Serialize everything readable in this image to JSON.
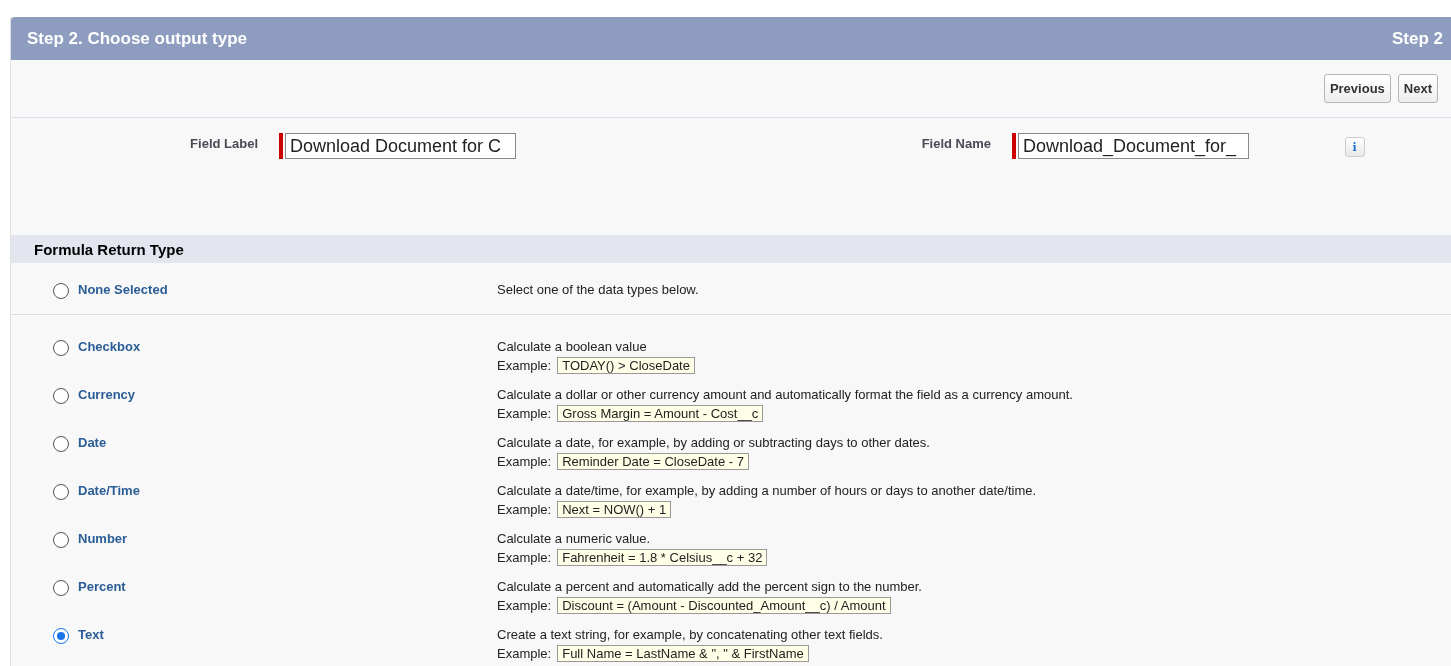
{
  "header": {
    "title": "Step 2. Choose output type",
    "step": "Step 2"
  },
  "buttons": [
    "Previous",
    "Next"
  ],
  "fields": [
    {
      "label": "Field Label",
      "value": "Download Document for C",
      "required": true
    },
    {
      "label": "Field Name",
      "value": "Download_Document_for_",
      "required": true,
      "info": "i"
    }
  ],
  "section": {
    "title": "Formula Return Type"
  },
  "types": [
    {
      "label": "None Selected",
      "selected": false,
      "description": "Select one of the data types below."
    },
    {
      "label": "Checkbox",
      "selected": false,
      "description": "Calculate a boolean value",
      "example_label": "Example:",
      "example": "TODAY() > CloseDate"
    },
    {
      "label": "Currency",
      "selected": false,
      "description": "Calculate a dollar or other currency amount and automatically format the field as a currency amount.",
      "example_label": "Example:",
      "example": "Gross Margin = Amount - Cost__c"
    },
    {
      "label": "Date",
      "selected": false,
      "description": "Calculate a date, for example, by adding or subtracting days to other dates.",
      "example_label": "Example:",
      "example": "Reminder Date = CloseDate - 7"
    },
    {
      "label": "Date/Time",
      "selected": false,
      "description": "Calculate a date/time, for example, by adding a number of hours or days to another date/time.",
      "example_label": "Example:",
      "example": "Next = NOW() + 1"
    },
    {
      "label": "Number",
      "selected": false,
      "description": "Calculate a numeric value.",
      "example_label": "Example:",
      "example": "Fahrenheit = 1.8 * Celsius__c + 32"
    },
    {
      "label": "Percent",
      "selected": false,
      "description": "Calculate a percent and automatically add the percent sign to the number.",
      "example_label": "Example:",
      "example": "Discount = (Amount - Discounted_Amount__c) / Amount"
    },
    {
      "label": "Text",
      "selected": true,
      "description": "Create a text string, for example, by concatenating other text fields.",
      "example_label": "Example:",
      "example": "Full Name = LastName & \", \" & FirstName"
    }
  ]
}
